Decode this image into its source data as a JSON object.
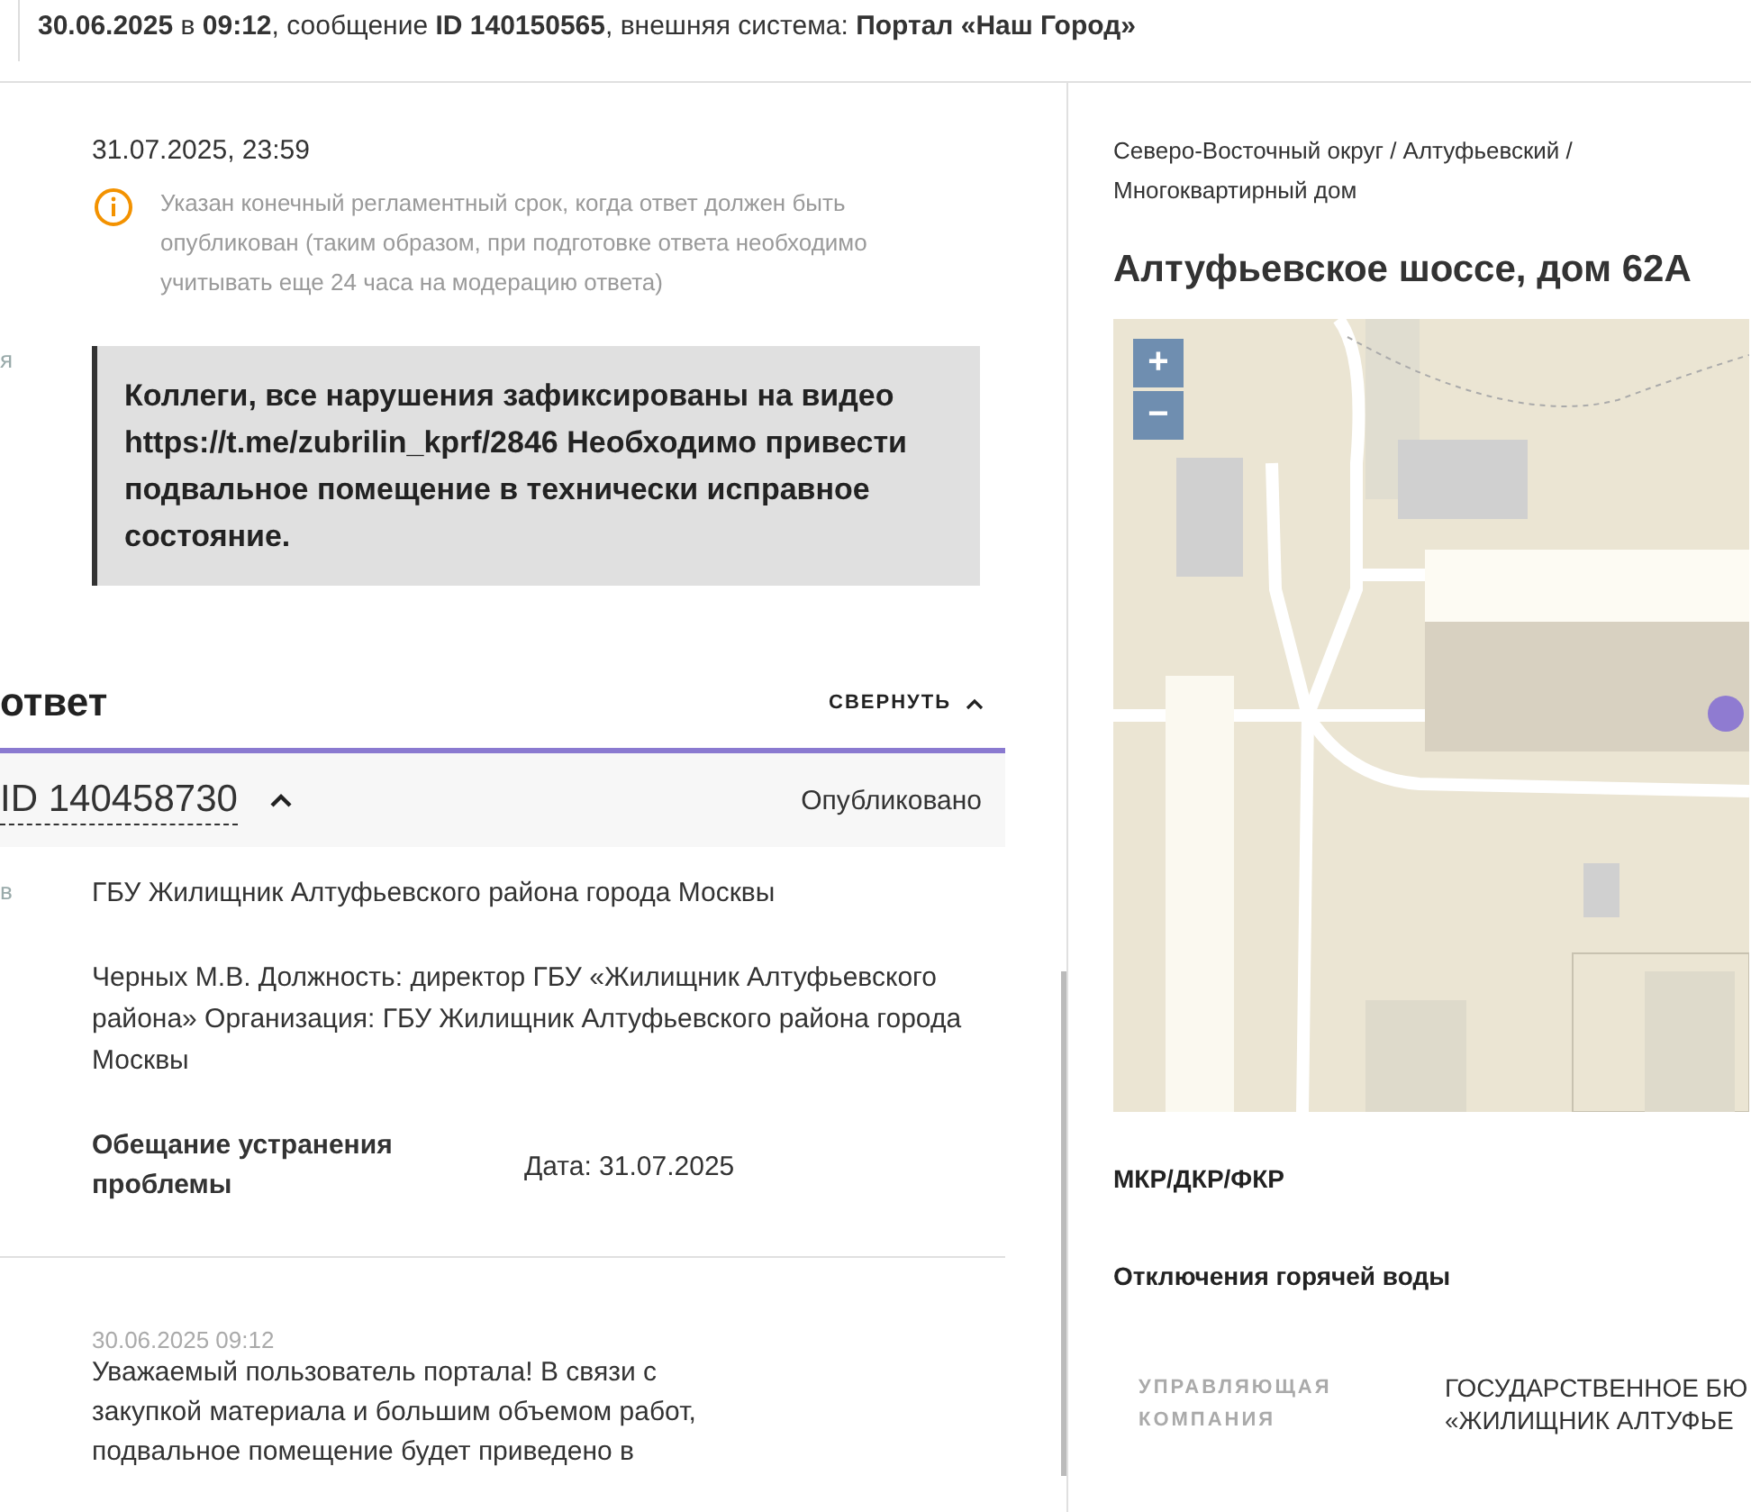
{
  "header": {
    "text": "**30.06.2025** в **09:12**, сообщение **ID 140150565**, внешняя система: **Портал «Наш Город»**"
  },
  "deadline": {
    "date": "31.07.2025, 23:59",
    "note": "Указан конечный регламентный срок, когда ответ должен быть опубликован (таким образом, при подготовке ответа необходимо учитывать еще 24 часа на модерацию ответа)"
  },
  "comment": {
    "label_fragment": "я",
    "text": "Коллеги, все нарушения зафиксированы на видео https://t.me/zubrilin_kprf/2846 Необходимо привести подвальное помещение в технически исправное состояние."
  },
  "answer": {
    "title": "ответ",
    "collapse_button": "СВЕРНУТЬ",
    "expanded": true,
    "id": "ID 140458730",
    "status": "Опубликовано",
    "executor_label_fragment": "в",
    "executor": "ГБУ Жилищник Алтуфьевского района города Москвы",
    "signer": "Черных М.В. Должность: директор ГБУ «Жилищник Алтуфьевского района» Организация: ГБУ Жилищник Алтуфьевского района города Москвы",
    "promise_label": "Обещание устранения проблемы",
    "promise_value": "Дата: 31.07.2025",
    "message_date": "30.06.2025 09:12",
    "message_lines": [
      "Уважаемый пользователь портала! В связи с",
      "закупкой материала и большим объемом работ,",
      "подвальное помещение будет приведено в"
    ]
  },
  "location": {
    "breadcrumb": "Северо-Восточный округ / Алтуфьевский / Многоквартирный дом",
    "title": "Алтуфьевское шоссе, дом 62А",
    "map": {
      "zoom_in": "+",
      "zoom_out": "−"
    },
    "sections": [
      "МКР/ДКР/ФКР",
      "Отключения горячей воды"
    ],
    "info_rows": [
      {
        "label": "УПРАВЛЯЮЩАЯ КОМПАНИЯ",
        "value_lines": [
          "ГОСУДАРСТВЕННОЕ БЮ",
          "«ЖИЛИЩНИК АЛТУФЬЕ"
        ]
      }
    ]
  }
}
